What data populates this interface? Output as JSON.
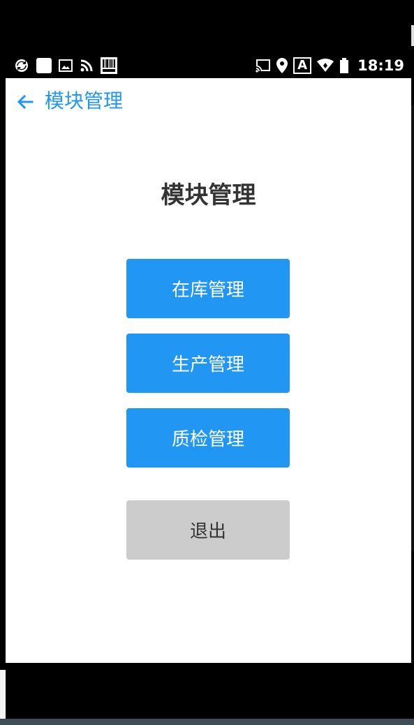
{
  "status_bar": {
    "time": "18:19",
    "left_icons": [
      "sync-icon",
      "square-notification-icon",
      "image-icon",
      "rss-icon",
      "barcode-icon"
    ],
    "right_icons": [
      "cast-icon",
      "location-icon",
      "keyboard-a-icon",
      "wifi-icon",
      "battery-icon"
    ],
    "keyboard_letter": "A"
  },
  "appbar": {
    "title": "模块管理"
  },
  "page": {
    "heading": "模块管理",
    "buttons": [
      {
        "label": "在库管理"
      },
      {
        "label": "生产管理"
      },
      {
        "label": "质检管理"
      }
    ],
    "exit_label": "退出"
  },
  "colors": {
    "accent": "#2196f3",
    "exit_bg": "#cccccc",
    "text_dark": "#333333"
  }
}
